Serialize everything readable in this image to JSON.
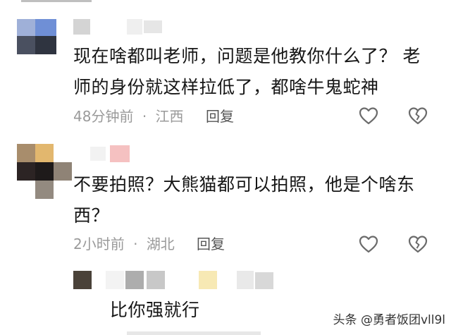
{
  "comments": [
    {
      "text_line1": "现在啥都叫老师，问题是他教你什么了？ 老",
      "text_line2": "师的身份就这样拉低了，都啥牛鬼蛇神",
      "time": "48分钟前",
      "separator": "·",
      "location": "江西",
      "reply_label": "回复"
    },
    {
      "text_line1": "不要拍照？大熊猫都可以拍照，他是个啥东",
      "text_line2": "西？",
      "time": "2小时前",
      "separator": "·",
      "location": "湖北",
      "reply_label": "回复"
    },
    {
      "text_line1": "比你强就行"
    }
  ],
  "watermark": "头条 @勇者饭团vll9l",
  "icons": {
    "like": "heart-outline-icon",
    "dislike": "broken-heart-icon"
  },
  "colors": {
    "meta": "#9a9a9a",
    "text": "#161616",
    "icon_stroke": "#6b6b6b"
  }
}
